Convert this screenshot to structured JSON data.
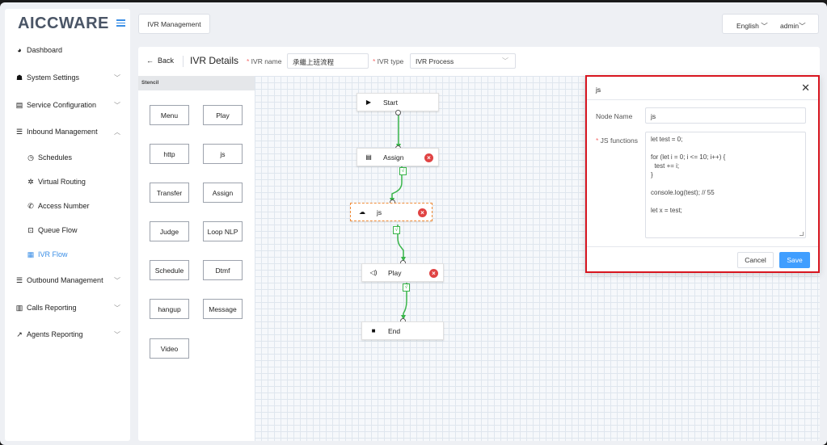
{
  "logo": "AICCWARE",
  "sidebar": {
    "items": [
      {
        "label": "Dashboard",
        "icon": "dashboard-icon"
      },
      {
        "label": "System Settings",
        "icon": "users-icon"
      },
      {
        "label": "Service Configuration",
        "icon": "id-card-icon"
      },
      {
        "label": "Inbound Management",
        "icon": "list-icon"
      },
      {
        "label": "Outbound Management",
        "icon": "list-icon"
      },
      {
        "label": "Calls Reporting",
        "icon": "bar-chart-icon"
      },
      {
        "label": "Agents Reporting",
        "icon": "line-chart-icon"
      }
    ],
    "subitems": [
      {
        "label": "Schedules",
        "icon": "clock-icon"
      },
      {
        "label": "Virtual Routing",
        "icon": "gear-icon"
      },
      {
        "label": "Access Number",
        "icon": "phone-icon"
      },
      {
        "label": "Queue Flow",
        "icon": "queue-icon"
      },
      {
        "label": "IVR Flow",
        "icon": "grid-icon"
      }
    ]
  },
  "topbar": {
    "tab": "IVR Management",
    "language": "English",
    "user": "admin"
  },
  "header": {
    "back": "Back",
    "title": "IVR Details",
    "name_label": "IVR name",
    "name_value": "承繼上班流程",
    "type_label": "IVR type",
    "type_value": "IVR Process"
  },
  "stencil": {
    "title": "Stencil",
    "buttons": [
      "Menu",
      "Play",
      "http",
      "js",
      "Transfer",
      "Assign",
      "Judge",
      "Loop NLP",
      "Schedule",
      "Dtmf",
      "hangup",
      "Message",
      "Video"
    ]
  },
  "flow": {
    "nodes": [
      {
        "label": "Start",
        "icon": "play-icon"
      },
      {
        "label": "Assign",
        "icon": "assign-icon"
      },
      {
        "label": "js",
        "icon": "cloud-icon"
      },
      {
        "label": "Play",
        "icon": "speaker-icon"
      },
      {
        "label": "End",
        "icon": "stop-icon"
      }
    ],
    "edge_label": "√"
  },
  "dialog": {
    "title": "js",
    "node_name_label": "Node Name",
    "node_name_value": "js",
    "js_label": "JS functions",
    "js_lines": [
      "let test = 0;",
      "",
      "for (let i = 0; i <= 10; i++) {",
      "  test += i;",
      "}",
      "",
      "console.log(test); // 55",
      "",
      "let x = test;"
    ],
    "cancel": "Cancel",
    "save": "Save"
  },
  "colors": {
    "accent": "#409eff",
    "edge": "#39b54a",
    "delete": "#e04343",
    "highlight": "#d8151f"
  }
}
